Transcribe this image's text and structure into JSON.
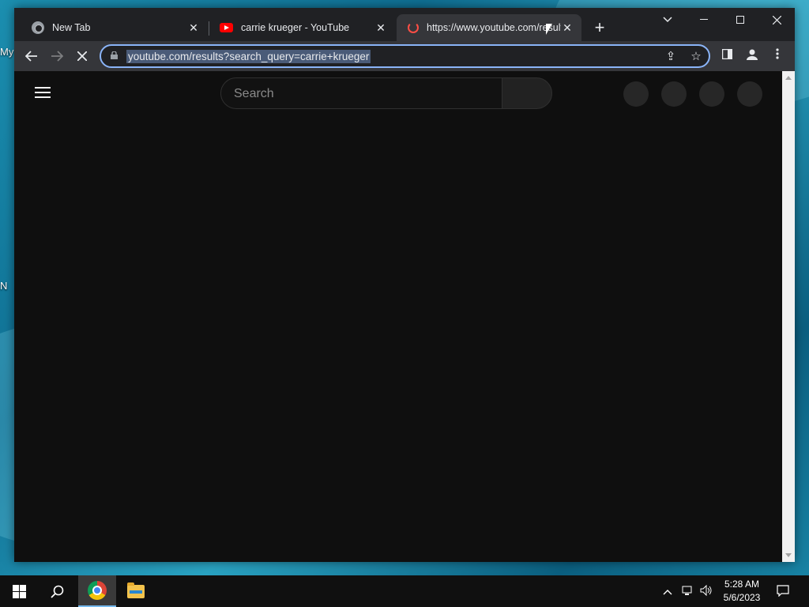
{
  "desktop": {
    "labels": [
      "My",
      "N"
    ]
  },
  "browser": {
    "tabs": [
      {
        "label": "New Tab",
        "icon": "chrome-icon",
        "active": false
      },
      {
        "label": "carrie krueger - YouTube",
        "icon": "youtube-icon",
        "active": false
      },
      {
        "label": "https://www.youtube.com/results",
        "icon": "loading-icon",
        "active": true
      }
    ],
    "new_tab_glyph": "+",
    "address_bar": {
      "url": "youtube.com/results?search_query=carrie+krueger"
    }
  },
  "page": {
    "search": {
      "placeholder": "Search"
    }
  },
  "taskbar": {
    "time": "5:28 AM",
    "date": "5/6/2023"
  },
  "colors": {
    "accent": "#8ab4f8",
    "page_bg": "#0f0f0f",
    "youtube_red": "#ff0000"
  }
}
